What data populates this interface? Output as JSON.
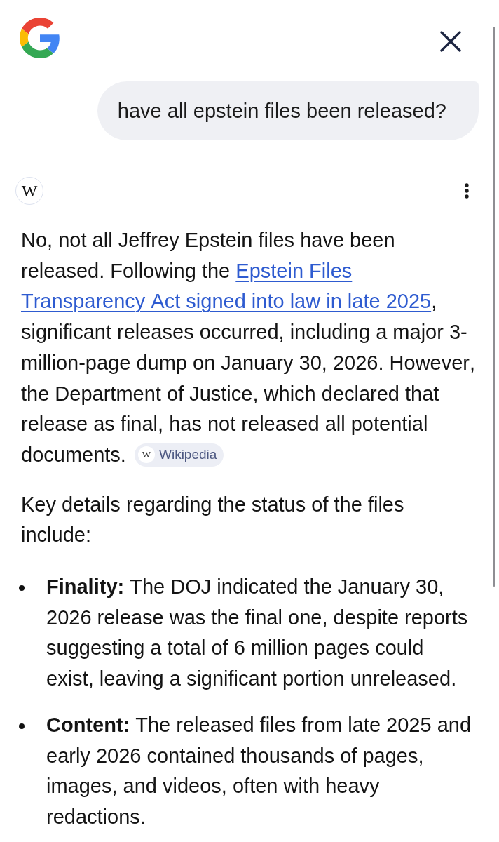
{
  "query": {
    "text": "have all epstein files been released?"
  },
  "source": {
    "badge": "W"
  },
  "answer": {
    "intro": [
      {
        "kind": "text",
        "text": "No, not all Jeffrey Epstein files have been released. Following the "
      },
      {
        "kind": "link",
        "lines": [
          "Epstein Files",
          "Transparency Act signed into law in late 2025"
        ]
      },
      {
        "kind": "text",
        "text": ", significant releases occurred, including a major 3-million-page dump on January 30, 2026. However, the Department of Justice, which declared that release as final, has not released all potential documents."
      },
      {
        "kind": "citation",
        "badge": "W",
        "label": "Wikipedia"
      }
    ],
    "lead": "Key details regarding the status of the files include:",
    "points": [
      "**Finality:** The DOJ indicated the January 30, 2026 release was the final one, despite reports suggesting a total of 6 million pages could exist, leaving a significant portion unreleased.",
      "**Content:** The released files from late 2025 and early 2026 contained thousands of pages, images, and videos, often with heavy redactions."
    ]
  }
}
